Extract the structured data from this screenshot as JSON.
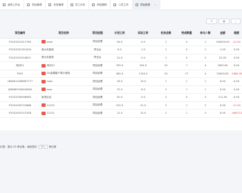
{
  "tabs": [
    {
      "label": "我的工作台",
      "active": false
    },
    {
      "label": "项目管理",
      "active": false
    },
    {
      "label": "任务管理",
      "active": false
    },
    {
      "label": "员工分析",
      "active": false
    },
    {
      "label": "风险跟踪",
      "active": false
    },
    {
      "label": "人员工作",
      "active": false
    },
    {
      "label": "项目报表",
      "active": true
    }
  ],
  "table": {
    "columns": [
      "项目编号",
      "项目名称",
      "项目经理",
      "计划工时",
      "实际工时",
      "任务总数",
      "完成数量",
      "参与人数",
      "金额",
      "差额"
    ],
    "rows": [
      {
        "id": "P2022022317783",
        "name": "saoh",
        "icon": true,
        "manager": "项目经理",
        "plan": "54.0",
        "actual": "0.0",
        "tasks": "1",
        "done": "0",
        "people": "1",
        "amount": "150000.00",
        "diff": "-22.00"
      },
      {
        "id": "P2022031351004",
        "name": "美大未超标",
        "icon": false,
        "manager": "李无女",
        "plan": "6.0",
        "actual": "1.0",
        "tasks": "1",
        "done": "0",
        "people": "1",
        "amount": "1.00",
        "diff": "0.00"
      },
      {
        "id": "P2022031516871",
        "name": "美大未超标",
        "icon": false,
        "manager": "李无女",
        "plan": "21.0",
        "actual": "0.0",
        "tasks": "1",
        "done": "0",
        "people": "2",
        "amount": "22.00",
        "diff": "0.00"
      },
      {
        "id": "测试01",
        "name": "测试01",
        "icon": true,
        "manager": "项目经理",
        "plan": "255.0",
        "actual": "254.0",
        "tasks": "10",
        "done": "7",
        "people": "4",
        "amount": "2900.00",
        "diff": "0.00"
      },
      {
        "id": "P001",
        "name": "OA金蝶客户端小程序",
        "icon": true,
        "manager": "项目经理",
        "plan": "480.0",
        "actual": "1154.0",
        "tasks": "24",
        "done": "17",
        "people": "4",
        "amount": "20000.00",
        "diff": "-1680.00"
      },
      {
        "id": "1664613268697777",
        "name": "main",
        "icon": true,
        "manager": "项目经理",
        "plan": "18.0",
        "actual": "10.0",
        "tasks": "1",
        "done": "1",
        "people": "1",
        "amount": "0.00",
        "diff": "0.00"
      },
      {
        "id": "JDKM69746418650",
        "name": "ssas",
        "icon": true,
        "manager": "项目经理",
        "plan": "72.0",
        "actual": "8.0",
        "tasks": "2",
        "done": "1",
        "people": "1",
        "amount": "0.00",
        "diff": "0.00"
      },
      {
        "id": "P2022030908983",
        "name": "新项目名",
        "icon": false,
        "manager": "项目经理",
        "plan": "30.0",
        "actual": "0.0",
        "tasks": "2",
        "done": "0",
        "people": "3",
        "amount": "111.00",
        "diff": "0.00"
      },
      {
        "id": "P2022030722688",
        "name": "11222",
        "icon": true,
        "manager": "项目经理",
        "plan": "222.0",
        "actual": "21.0",
        "tasks": "2",
        "done": "1",
        "people": "2",
        "amount": "0.00",
        "diff": "-11.00"
      },
      {
        "id": "P2022031072358",
        "name": "12121",
        "icon": true,
        "manager": "项目经理",
        "plan": "11.0",
        "actual": "12.0",
        "tasks": "2",
        "done": "1",
        "people": "2",
        "amount": "0.00",
        "diff": "-16675.00"
      }
    ]
  },
  "pager": {
    "text": "记录：显示 25 条记录，每页显示",
    "page_size": "10",
    "suffix": "条记录"
  }
}
